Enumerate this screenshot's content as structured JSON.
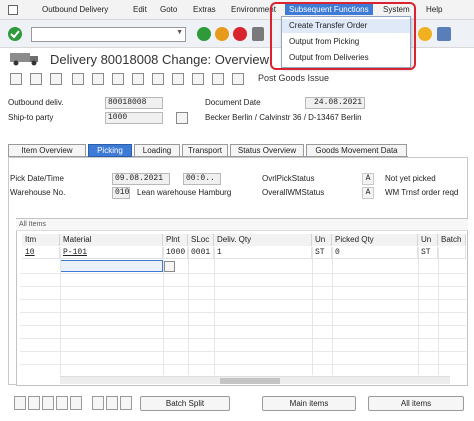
{
  "menubar": {
    "items": [
      "Outbound Delivery",
      "Edit",
      "Goto",
      "Extras",
      "Environment",
      "Subsequent Functions",
      "System",
      "Help"
    ]
  },
  "subsequent_menu": {
    "items": [
      "Create Transfer Order",
      "Output from Picking",
      "Output from Deliveries"
    ]
  },
  "title": "Delivery 80018008 Change: Overview",
  "app_toolbar": {
    "post_goods_issue": "Post Goods Issue"
  },
  "header": {
    "outbound_delivery_label": "Outbound deliv.",
    "outbound_delivery_value": "80018008",
    "ship_to_label": "Ship-to party",
    "ship_to_value": "1000",
    "document_date_label": "Document Date",
    "document_date_value": "24.08.2021",
    "ship_to_name": "Becker Berlin / Calvinstr 36 / D-13467 Berlin"
  },
  "tabs": [
    "Item Overview",
    "Picking",
    "Loading",
    "Transport",
    "Status Overview",
    "Goods Movement Data"
  ],
  "active_tab": "Picking",
  "picking": {
    "pick_date_label": "Pick Date/Time",
    "pick_date_value": "09.08.2021",
    "pick_time_value": "00:0..",
    "warehouse_label": "Warehouse No.",
    "warehouse_value": "010",
    "warehouse_name": "Lean warehouse Hamburg",
    "ovrl_pick_label": "OvrlPickStatus",
    "ovrl_pick_value": "A",
    "ovrl_pick_text": "Not yet picked",
    "ovrl_wm_label": "OverallWMStatus",
    "ovrl_wm_value": "A",
    "ovrl_wm_text": "WM Trnsf order reqd"
  },
  "table": {
    "title": "All Items",
    "columns": [
      "Itm",
      "Material",
      "Plnt",
      "SLoc",
      "Deliv. Qty",
      "Un",
      "Picked Qty",
      "Un",
      "Batch"
    ],
    "rows": [
      [
        "10",
        "P-101",
        "1000",
        "0001",
        "1",
        "ST",
        "0",
        "ST",
        ""
      ]
    ]
  },
  "buttons": {
    "batch_split": "Batch Split",
    "main_items": "Main items",
    "all_items": "All items"
  },
  "colors": {
    "accent": "#3d7bd6",
    "highlight_frame": "#d9232e"
  }
}
